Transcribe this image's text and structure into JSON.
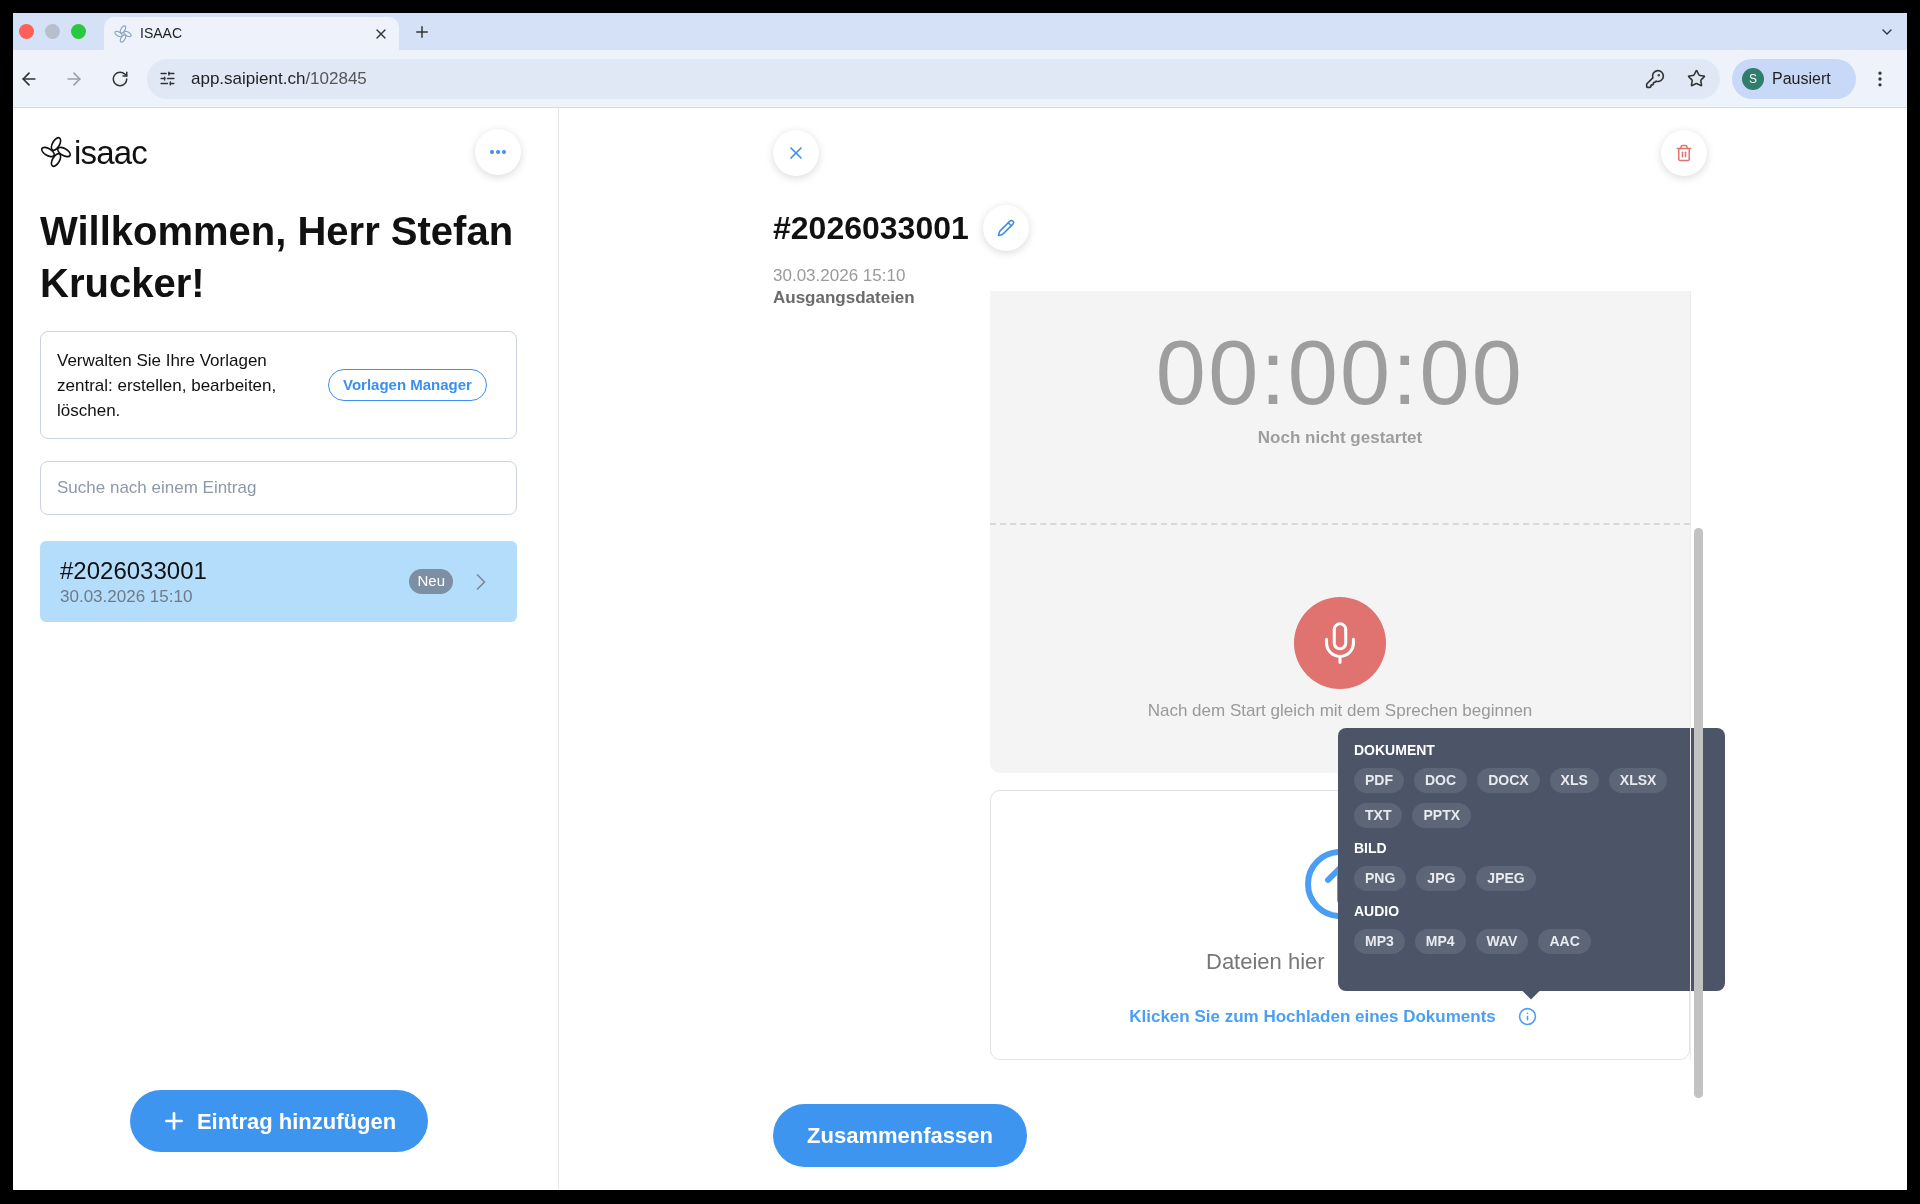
{
  "browser": {
    "tab_title": "ISAAC",
    "url_host": "app.saipient.ch",
    "url_path": "/102845",
    "profile_initial": "S",
    "profile_label": "Pausiert"
  },
  "sidebar": {
    "logo_text": "isaac",
    "heading": "Willkommen, Herr Stefan Krucker!",
    "templates_card": {
      "text": "Verwalten Sie Ihre Vorlagen zentral: erstellen, bearbeiten, löschen.",
      "button": "Vorlagen Manager"
    },
    "search": {
      "placeholder": "Suche nach einem Eintrag"
    },
    "entries": [
      {
        "title": "#2026033001",
        "date": "30.03.2026 15:10",
        "badge": "Neu",
        "selected": true
      }
    ],
    "add_button": "Eintrag hinzufügen"
  },
  "detail": {
    "title": "#2026033001",
    "date": "30.03.2026 15:10",
    "section_label": "Ausgangsdateien",
    "timer": "00:00:00",
    "status": "Noch nicht gestartet",
    "hint": "Nach dem Start gleich mit dem Sprechen beginnen",
    "upload_text": "Dateien hier",
    "upload_link": "Klicken Sie zum Hochladen eines Dokuments",
    "summarize_button": "Zusammenfassen"
  },
  "tooltip": {
    "groups": [
      {
        "label": "DOKUMENT",
        "formats": [
          "PDF",
          "DOC",
          "DOCX",
          "XLS",
          "XLSX",
          "TXT",
          "PPTX"
        ]
      },
      {
        "label": "BILD",
        "formats": [
          "PNG",
          "JPG",
          "JPEG"
        ]
      },
      {
        "label": "AUDIO",
        "formats": [
          "MP3",
          "MP4",
          "WAV",
          "AAC"
        ]
      }
    ]
  }
}
